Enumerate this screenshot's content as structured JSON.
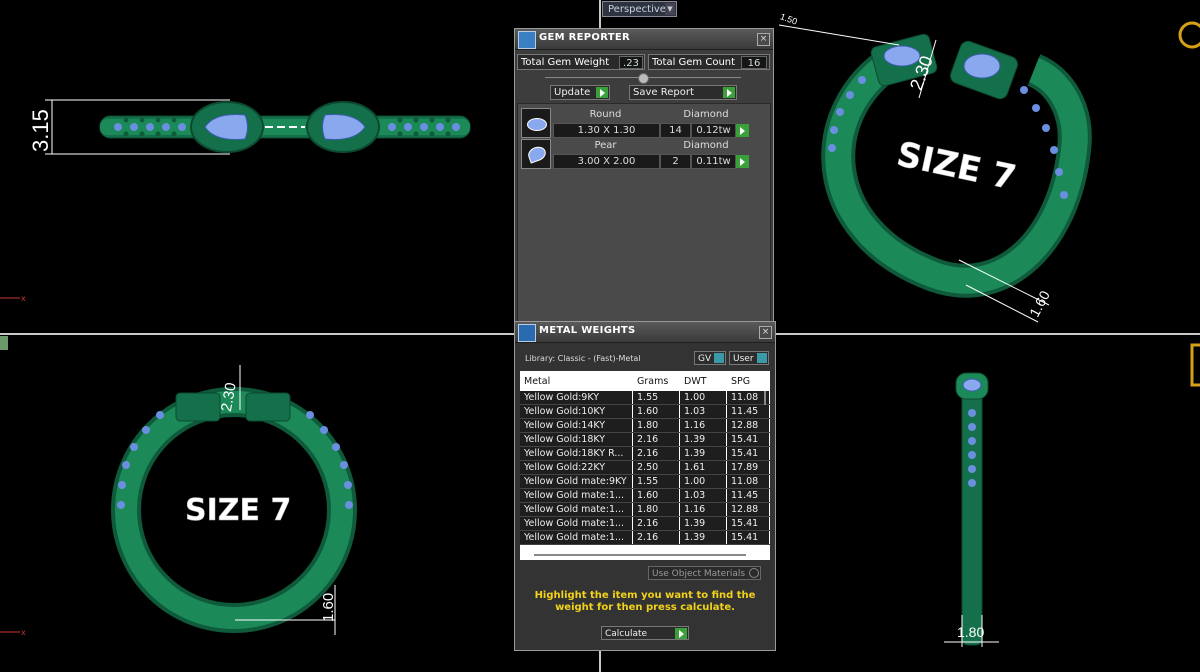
{
  "viewport": {
    "label": "Perspective",
    "size_text": "SIZE 7",
    "dims": {
      "top_left": "3.15",
      "top_right_a": "2.30",
      "top_right_b": "1.60",
      "top_right_c": "1.50",
      "bottom_left_a": "2.30",
      "bottom_left_b": "1.60",
      "bottom_right": "1.80"
    },
    "colors": {
      "metal": "#1a7a52",
      "stone": "#6a8fe0",
      "grid": "#c8c8c8"
    }
  },
  "gem_reporter": {
    "title": "GEM REPORTER",
    "total_weight_label": "Total Gem Weight",
    "total_weight_value": ".23",
    "total_count_label": "Total Gem Count",
    "total_count_value": "16",
    "update_label": "Update",
    "save_label": "Save Report",
    "gems": [
      {
        "shape": "Round",
        "type": "Diamond",
        "size": "1.30 X 1.30",
        "count": "14",
        "weight": "0.12tw"
      },
      {
        "shape": "Pear",
        "type": "Diamond",
        "size": "3.00 X 2.00",
        "count": "2",
        "weight": "0.11tw"
      }
    ]
  },
  "metal_weights": {
    "title": "METAL WEIGHTS",
    "library": "Library: Classic - (Fast)-Metal",
    "gv_label": "GV",
    "user_label": "User",
    "columns": [
      "Metal",
      "Grams",
      "DWT",
      "SPG"
    ],
    "rows": [
      [
        "Yellow Gold:9KY",
        "1.55",
        "1.00",
        "11.08"
      ],
      [
        "Yellow Gold:10KY",
        "1.60",
        "1.03",
        "11.45"
      ],
      [
        "Yellow Gold:14KY",
        "1.80",
        "1.16",
        "12.88"
      ],
      [
        "Yellow Gold:18KY",
        "2.16",
        "1.39",
        "15.41"
      ],
      [
        "Yellow Gold:18KY R...",
        "2.16",
        "1.39",
        "15.41"
      ],
      [
        "Yellow Gold:22KY",
        "2.50",
        "1.61",
        "17.89"
      ],
      [
        "Yellow Gold mate:9KY",
        "1.55",
        "1.00",
        "11.08"
      ],
      [
        "Yellow Gold mate:1...",
        "1.60",
        "1.03",
        "11.45"
      ],
      [
        "Yellow Gold mate:1...",
        "1.80",
        "1.16",
        "12.88"
      ],
      [
        "Yellow Gold mate:1...",
        "2.16",
        "1.39",
        "15.41"
      ],
      [
        "Yellow Gold mate:1...",
        "2.16",
        "1.39",
        "15.41"
      ]
    ],
    "use_object_label": "Use Object Materials",
    "hint": "Highlight the item you want to find the weight for then press calculate.",
    "calculate_label": "Calculate"
  }
}
